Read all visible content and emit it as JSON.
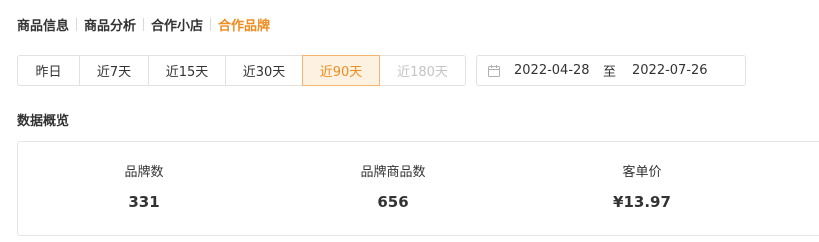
{
  "nav_tabs": [
    {
      "label": "商品信息",
      "active": false
    },
    {
      "label": "商品分析",
      "active": false
    },
    {
      "label": "合作小店",
      "active": false
    },
    {
      "label": "合作品牌",
      "active": true
    }
  ],
  "date_range": {
    "options": [
      {
        "label": "昨日",
        "state": "normal"
      },
      {
        "label": "近7天",
        "state": "normal"
      },
      {
        "label": "近15天",
        "state": "normal"
      },
      {
        "label": "近30天",
        "state": "normal"
      },
      {
        "label": "近90天",
        "state": "active"
      },
      {
        "label": "近180天",
        "state": "disabled"
      }
    ],
    "start_date": "2022-04-28",
    "separator": "至",
    "end_date": "2022-07-26",
    "icon": "calendar-icon"
  },
  "overview": {
    "title": "数据概览",
    "metrics": [
      {
        "label": "品牌数",
        "value": "331"
      },
      {
        "label": "品牌商品数",
        "value": "656"
      },
      {
        "label": "客单价",
        "value": "¥13.97"
      }
    ]
  },
  "colors": {
    "accent": "#f08c1e",
    "accent_bg": "#fdf1e2",
    "border": "#e1e1e1",
    "text": "#333333",
    "disabled_text": "#c4c4c4"
  }
}
